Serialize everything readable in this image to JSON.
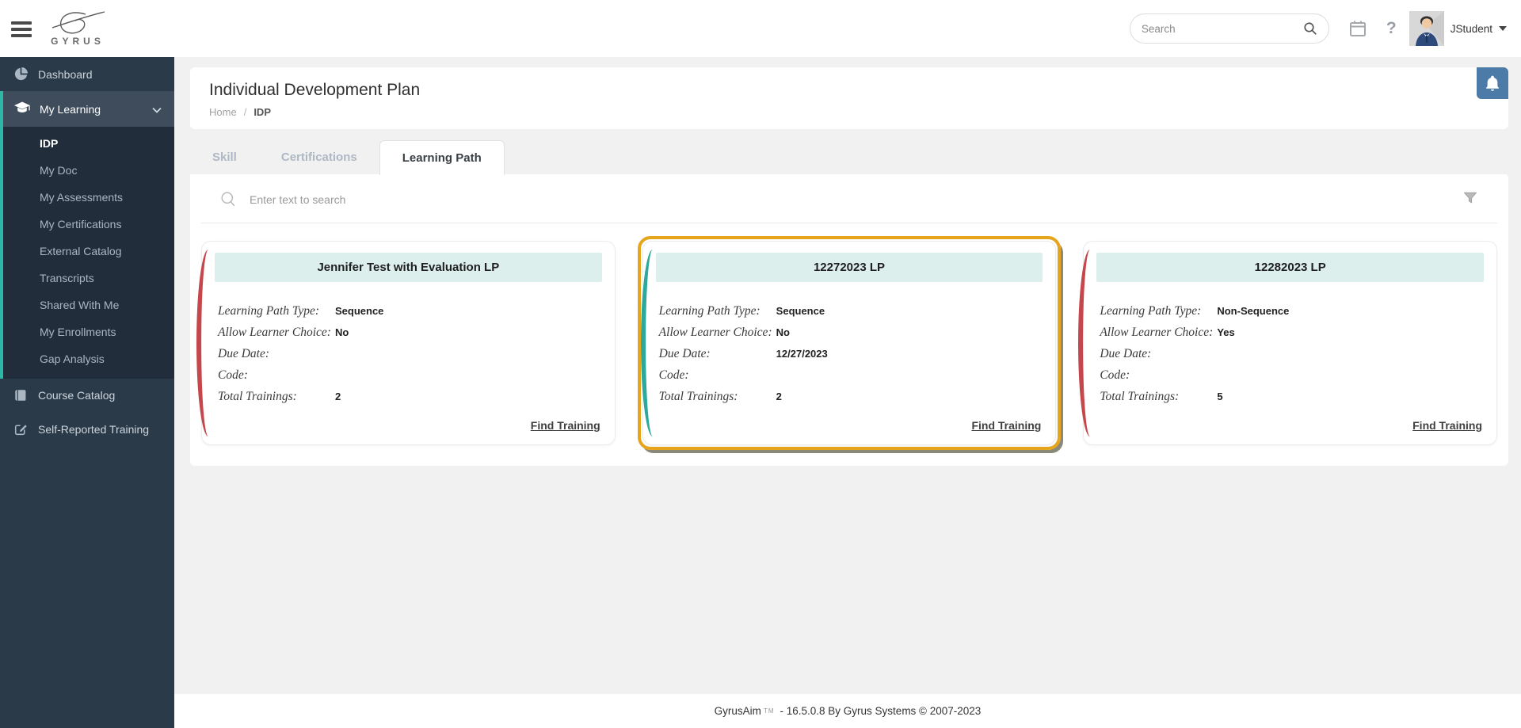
{
  "topbar": {
    "brand": "GYRUS",
    "search_placeholder": "Search",
    "username": "JStudent",
    "help_glyph": "?",
    "icons": [
      "menu-icon",
      "search-icon",
      "calendar-icon",
      "help-icon",
      "avatar",
      "caret-down-icon"
    ]
  },
  "sidebar": {
    "dashboard": {
      "label": "Dashboard",
      "icon": "pie-chart-icon"
    },
    "my_learning": {
      "label": "My Learning",
      "icon": "graduation-cap-icon",
      "chevron": "chevron-down-icon",
      "expanded": true
    },
    "children": [
      {
        "label": "IDP",
        "active": true
      },
      {
        "label": "My Doc"
      },
      {
        "label": "My Assessments"
      },
      {
        "label": "My Certifications"
      },
      {
        "label": "External Catalog"
      },
      {
        "label": "Transcripts"
      },
      {
        "label": "Shared With Me"
      },
      {
        "label": "My Enrollments"
      },
      {
        "label": "Gap Analysis"
      }
    ],
    "course_catalog": {
      "label": "Course Catalog",
      "icon": "book-icon"
    },
    "self_reported": {
      "label": "Self-Reported Training",
      "icon": "pencil-square-icon"
    }
  },
  "page": {
    "title": "Individual Development Plan",
    "breadcrumb": {
      "home": "Home",
      "separator": "/",
      "current": "IDP"
    },
    "bell_icon": "bell-icon"
  },
  "tabs": [
    {
      "label": "Skill",
      "active": false
    },
    {
      "label": "Certifications",
      "active": false
    },
    {
      "label": "Learning Path",
      "active": true
    }
  ],
  "toolbar": {
    "search_placeholder": "Enter text to search",
    "filter_icon": "filter-icon"
  },
  "cards": [
    {
      "title": "Jennifer Test with Evaluation LP",
      "accent_color": "#c5474b",
      "highlighted": false,
      "fields": [
        {
          "label": "Learning Path Type:",
          "value": "Sequence"
        },
        {
          "label": "Allow Learner Choice:",
          "value": "No"
        },
        {
          "label": "Due Date:",
          "value": ""
        },
        {
          "label": "Code:",
          "value": ""
        },
        {
          "label": "Total Trainings:",
          "value": "2"
        }
      ],
      "link": "Find Training"
    },
    {
      "title": "12272023 LP",
      "accent_color": "#2aa99c",
      "highlighted": true,
      "highlight_color": "#e7a51d",
      "fields": [
        {
          "label": "Learning Path Type:",
          "value": "Sequence"
        },
        {
          "label": "Allow Learner Choice:",
          "value": "No"
        },
        {
          "label": "Due Date:",
          "value": "12/27/2023"
        },
        {
          "label": "Code:",
          "value": ""
        },
        {
          "label": "Total Trainings:",
          "value": "2"
        }
      ],
      "link": "Find Training"
    },
    {
      "title": "12282023 LP",
      "accent_color": "#c5474b",
      "highlighted": false,
      "fields": [
        {
          "label": "Learning Path Type:",
          "value": "Non-Sequence"
        },
        {
          "label": "Allow Learner Choice:",
          "value": "Yes"
        },
        {
          "label": "Due Date:",
          "value": ""
        },
        {
          "label": "Code:",
          "value": ""
        },
        {
          "label": "Total Trainings:",
          "value": "5"
        }
      ],
      "link": "Find Training"
    }
  ],
  "footer": {
    "product": "GyrusAim",
    "tm": "TM",
    "rest": "- 16.5.0.8 By Gyrus Systems © 2007-2023"
  },
  "colors": {
    "sidebar_bg": "#2b3a48",
    "sidebar_group_bg": "#3e4c5b",
    "sidebar_submenu_bg": "#222d3b",
    "accent_teal_bar": "#2cb8a5",
    "card_accent_red": "#c5474b",
    "card_accent_teal": "#2aa99c",
    "highlight_orange": "#e7a51d",
    "card_title_bg": "#dcefed",
    "bell_bg": "#4d7ba7",
    "page_bg": "#f1f1f1"
  }
}
